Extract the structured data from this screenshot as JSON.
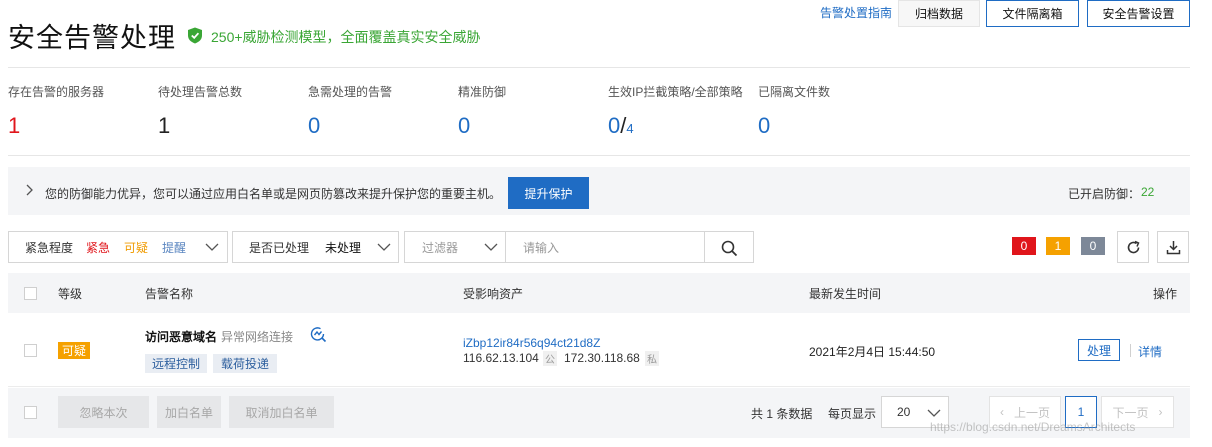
{
  "header": {
    "title": "安全告警处理",
    "subtitle": "250+威胁检测模型，全面覆盖真实安全威胁",
    "guide_link": "告警处置指南",
    "archive_button": "归档数据",
    "quarantine_button": "文件隔离箱",
    "settings_button": "安全告警设置"
  },
  "stats": [
    {
      "label": "存在告警的服务器",
      "value": "1"
    },
    {
      "label": "待处理告警总数",
      "value": "1"
    },
    {
      "label": "急需处理的告警",
      "value": "0"
    },
    {
      "label": "精准防御",
      "value": "0"
    },
    {
      "label": "生效IP拦截策略/全部策略",
      "value": "0",
      "sep": "/",
      "total": "4"
    },
    {
      "label": "已隔离文件数",
      "value": "0"
    }
  ],
  "banner": {
    "text": "您的防御能力优异，您可以通过应用白名单或是网页防篡改来提升保护您的重要主机。",
    "button": "提升保护",
    "defense_label": "已开启防御：",
    "defense_count": "22"
  },
  "filters": {
    "severity_label": "紧急程度",
    "severity_tags": [
      "紧急",
      "可疑",
      "提醒"
    ],
    "handled_label": "是否已处理",
    "handled_value": "未处理",
    "filter_placeholder": "过滤器",
    "search_placeholder": "请输入",
    "counts": [
      "0",
      "1",
      "0"
    ],
    "count_colors": [
      "#e0151b",
      "#f5a100",
      "#7d8898"
    ]
  },
  "table": {
    "columns": [
      "等级",
      "告警名称",
      "受影响资产",
      "最新发生时间",
      "操作"
    ],
    "rows": [
      {
        "level": "可疑",
        "name": "访问恶意域名",
        "subname": "异常网络连接",
        "tags": [
          "远程控制",
          "载荷投递"
        ],
        "asset_id": "iZbp12ir84r56q94ct21d8Z",
        "public_ip": "116.62.13.104",
        "public_tag": "公",
        "private_ip": "172.30.118.68",
        "private_tag": "私",
        "time": "2021年2月4日 15:44:50",
        "action_handle": "处理",
        "action_detail": "详情"
      }
    ]
  },
  "footer": {
    "ignore_button": "忽略本次",
    "whitelist_button": "加白名单",
    "cancel_whitelist_button": "取消加白名单",
    "total_text": "共 1 条数据",
    "per_page_label": "每页显示",
    "per_page_value": "20",
    "prev": "上一页",
    "page": "1",
    "next": "下一页"
  },
  "watermark": "https://blog.csdn.net/DreamsArchitects"
}
